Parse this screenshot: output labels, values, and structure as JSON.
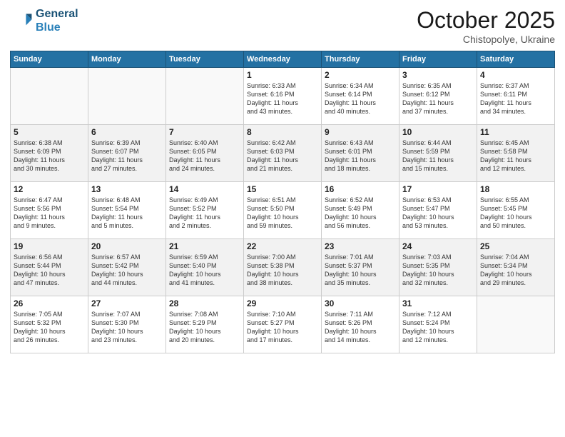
{
  "header": {
    "logo_general": "General",
    "logo_blue": "Blue",
    "month": "October 2025",
    "location": "Chistopolye, Ukraine"
  },
  "weekdays": [
    "Sunday",
    "Monday",
    "Tuesday",
    "Wednesday",
    "Thursday",
    "Friday",
    "Saturday"
  ],
  "weeks": [
    [
      {
        "day": "",
        "info": "",
        "empty": true
      },
      {
        "day": "",
        "info": "",
        "empty": true
      },
      {
        "day": "",
        "info": "",
        "empty": true
      },
      {
        "day": "1",
        "info": "Sunrise: 6:33 AM\nSunset: 6:16 PM\nDaylight: 11 hours\nand 43 minutes."
      },
      {
        "day": "2",
        "info": "Sunrise: 6:34 AM\nSunset: 6:14 PM\nDaylight: 11 hours\nand 40 minutes."
      },
      {
        "day": "3",
        "info": "Sunrise: 6:35 AM\nSunset: 6:12 PM\nDaylight: 11 hours\nand 37 minutes."
      },
      {
        "day": "4",
        "info": "Sunrise: 6:37 AM\nSunset: 6:11 PM\nDaylight: 11 hours\nand 34 minutes."
      }
    ],
    [
      {
        "day": "5",
        "info": "Sunrise: 6:38 AM\nSunset: 6:09 PM\nDaylight: 11 hours\nand 30 minutes."
      },
      {
        "day": "6",
        "info": "Sunrise: 6:39 AM\nSunset: 6:07 PM\nDaylight: 11 hours\nand 27 minutes."
      },
      {
        "day": "7",
        "info": "Sunrise: 6:40 AM\nSunset: 6:05 PM\nDaylight: 11 hours\nand 24 minutes."
      },
      {
        "day": "8",
        "info": "Sunrise: 6:42 AM\nSunset: 6:03 PM\nDaylight: 11 hours\nand 21 minutes."
      },
      {
        "day": "9",
        "info": "Sunrise: 6:43 AM\nSunset: 6:01 PM\nDaylight: 11 hours\nand 18 minutes."
      },
      {
        "day": "10",
        "info": "Sunrise: 6:44 AM\nSunset: 5:59 PM\nDaylight: 11 hours\nand 15 minutes."
      },
      {
        "day": "11",
        "info": "Sunrise: 6:45 AM\nSunset: 5:58 PM\nDaylight: 11 hours\nand 12 minutes."
      }
    ],
    [
      {
        "day": "12",
        "info": "Sunrise: 6:47 AM\nSunset: 5:56 PM\nDaylight: 11 hours\nand 9 minutes."
      },
      {
        "day": "13",
        "info": "Sunrise: 6:48 AM\nSunset: 5:54 PM\nDaylight: 11 hours\nand 5 minutes."
      },
      {
        "day": "14",
        "info": "Sunrise: 6:49 AM\nSunset: 5:52 PM\nDaylight: 11 hours\nand 2 minutes."
      },
      {
        "day": "15",
        "info": "Sunrise: 6:51 AM\nSunset: 5:50 PM\nDaylight: 10 hours\nand 59 minutes."
      },
      {
        "day": "16",
        "info": "Sunrise: 6:52 AM\nSunset: 5:49 PM\nDaylight: 10 hours\nand 56 minutes."
      },
      {
        "day": "17",
        "info": "Sunrise: 6:53 AM\nSunset: 5:47 PM\nDaylight: 10 hours\nand 53 minutes."
      },
      {
        "day": "18",
        "info": "Sunrise: 6:55 AM\nSunset: 5:45 PM\nDaylight: 10 hours\nand 50 minutes."
      }
    ],
    [
      {
        "day": "19",
        "info": "Sunrise: 6:56 AM\nSunset: 5:44 PM\nDaylight: 10 hours\nand 47 minutes."
      },
      {
        "day": "20",
        "info": "Sunrise: 6:57 AM\nSunset: 5:42 PM\nDaylight: 10 hours\nand 44 minutes."
      },
      {
        "day": "21",
        "info": "Sunrise: 6:59 AM\nSunset: 5:40 PM\nDaylight: 10 hours\nand 41 minutes."
      },
      {
        "day": "22",
        "info": "Sunrise: 7:00 AM\nSunset: 5:38 PM\nDaylight: 10 hours\nand 38 minutes."
      },
      {
        "day": "23",
        "info": "Sunrise: 7:01 AM\nSunset: 5:37 PM\nDaylight: 10 hours\nand 35 minutes."
      },
      {
        "day": "24",
        "info": "Sunrise: 7:03 AM\nSunset: 5:35 PM\nDaylight: 10 hours\nand 32 minutes."
      },
      {
        "day": "25",
        "info": "Sunrise: 7:04 AM\nSunset: 5:34 PM\nDaylight: 10 hours\nand 29 minutes."
      }
    ],
    [
      {
        "day": "26",
        "info": "Sunrise: 7:05 AM\nSunset: 5:32 PM\nDaylight: 10 hours\nand 26 minutes."
      },
      {
        "day": "27",
        "info": "Sunrise: 7:07 AM\nSunset: 5:30 PM\nDaylight: 10 hours\nand 23 minutes."
      },
      {
        "day": "28",
        "info": "Sunrise: 7:08 AM\nSunset: 5:29 PM\nDaylight: 10 hours\nand 20 minutes."
      },
      {
        "day": "29",
        "info": "Sunrise: 7:10 AM\nSunset: 5:27 PM\nDaylight: 10 hours\nand 17 minutes."
      },
      {
        "day": "30",
        "info": "Sunrise: 7:11 AM\nSunset: 5:26 PM\nDaylight: 10 hours\nand 14 minutes."
      },
      {
        "day": "31",
        "info": "Sunrise: 7:12 AM\nSunset: 5:24 PM\nDaylight: 10 hours\nand 12 minutes."
      },
      {
        "day": "",
        "info": "",
        "empty": true
      }
    ]
  ]
}
